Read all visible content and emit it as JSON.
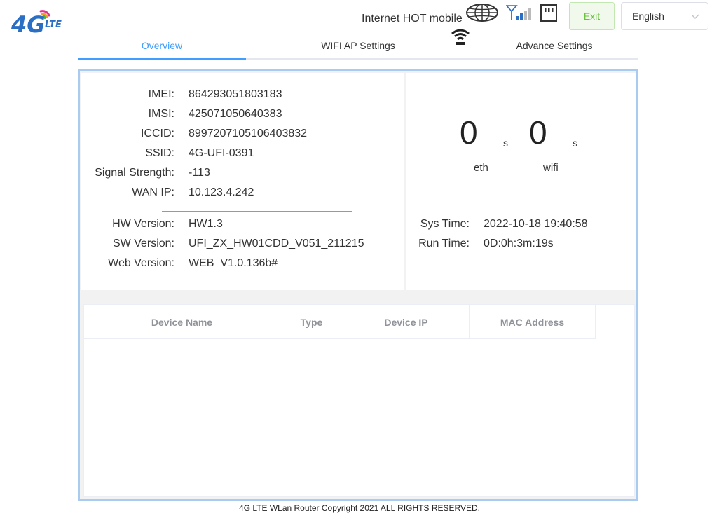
{
  "header": {
    "operator": "Internet HOT mobile",
    "exit_label": "Exit",
    "language": "English",
    "icons": [
      "logo-icon",
      "globe-icon",
      "signal-icon",
      "sim-icon",
      "wifi-icon",
      "chevron-down-icon"
    ],
    "colors": {
      "accent": "#409eff",
      "exit_bg": "#f0f9eb",
      "exit_text": "#67c23a",
      "frame": "#a8cbef",
      "logo": "#2a6fc4"
    }
  },
  "tabs": [
    {
      "label": "Overview",
      "active": true
    },
    {
      "label": "WIFI AP Settings",
      "active": false
    },
    {
      "label": "Advance Settings",
      "active": false
    }
  ],
  "device_info": {
    "rows": [
      {
        "key": "IMEI:",
        "value": "864293051803183"
      },
      {
        "key": "IMSI:",
        "value": "425071050640383"
      },
      {
        "key": "ICCID:",
        "value": "8997207105106403832"
      },
      {
        "key": "SSID:",
        "value": "4G-UFI-0391"
      },
      {
        "key": "Signal Strength:",
        "value": "-113"
      },
      {
        "key": "WAN IP:",
        "value": "10.123.4.242"
      }
    ],
    "version_rows": [
      {
        "key": "HW Version:",
        "value": "HW1.3"
      },
      {
        "key": "SW Version:",
        "value": "UFI_ZX_HW01CDD_V051_211215"
      },
      {
        "key": "Web Version:",
        "value": "WEB_V1.0.136b#"
      }
    ]
  },
  "stats": {
    "eth_count": "0",
    "eth_unit": "s",
    "eth_label": "eth",
    "wifi_count": "0",
    "wifi_unit": "s",
    "wifi_label": "wifi",
    "sys_time_label": "Sys Time:",
    "sys_time": "2022-10-18 19:40:58",
    "run_time_label": "Run Time:",
    "run_time": "0D:0h:3m:19s"
  },
  "devices_table": {
    "columns": [
      "Device Name",
      "Type",
      "Device IP",
      "MAC Address"
    ],
    "rows": []
  },
  "footer": "4G LTE WLan Router Copyright 2021 ALL RIGHTS RESERVED."
}
